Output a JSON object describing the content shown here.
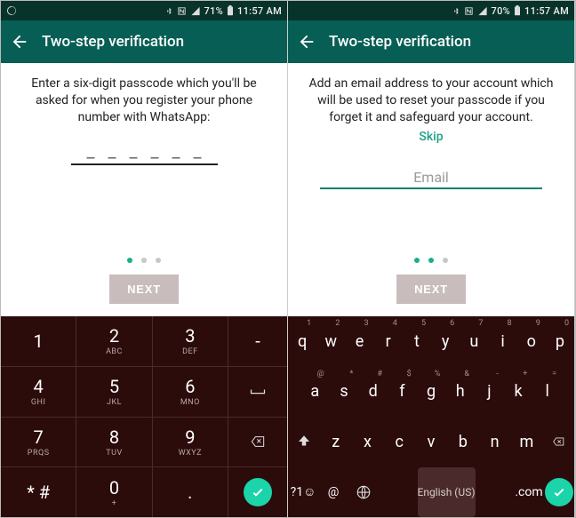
{
  "left": {
    "status": {
      "battery": "71%",
      "time": "11:57 AM"
    },
    "appbar": {
      "title": "Two-step verification"
    },
    "instruction": "Enter a six-digit passcode which you'll be asked for when you register your phone number with WhatsApp:",
    "dots": [
      true,
      false,
      false
    ],
    "next": "NEXT",
    "numpad": {
      "r1": [
        {
          "big": "1",
          "sub": ""
        },
        {
          "big": "2",
          "sub": "ABC"
        },
        {
          "big": "3",
          "sub": "DEF"
        },
        {
          "big": "-",
          "sub": ""
        }
      ],
      "r2": [
        {
          "big": "4",
          "sub": "GHI"
        },
        {
          "big": "5",
          "sub": "JKL"
        },
        {
          "big": "6",
          "sub": "MNO"
        },
        {
          "big": "␣",
          "sub": ""
        }
      ],
      "r3": [
        {
          "big": "7",
          "sub": "PRQS"
        },
        {
          "big": "8",
          "sub": "TUV"
        },
        {
          "big": "9",
          "sub": "WXYZ"
        },
        {
          "big": "⌫",
          "sub": ""
        }
      ],
      "r4": [
        {
          "big": "* #",
          "sub": ""
        },
        {
          "big": "0",
          "sub": "+"
        },
        {
          "big": ".",
          "sub": ""
        },
        {
          "big": "✓",
          "sub": ""
        }
      ]
    }
  },
  "right": {
    "status": {
      "battery": "70%",
      "time": "11:57 AM"
    },
    "appbar": {
      "title": "Two-step verification"
    },
    "instruction": "Add an email address to your account which will be used to reset your passcode if you forget it and safeguard your account.",
    "skip": "Skip",
    "email_placeholder": "Email",
    "dots": [
      true,
      true,
      false
    ],
    "next": "NEXT",
    "qwerty": {
      "r1": [
        {
          "m": "q",
          "h": "1"
        },
        {
          "m": "w",
          "h": "2"
        },
        {
          "m": "e",
          "h": "3"
        },
        {
          "m": "r",
          "h": "4"
        },
        {
          "m": "t",
          "h": "5"
        },
        {
          "m": "y",
          "h": "6"
        },
        {
          "m": "u",
          "h": "7"
        },
        {
          "m": "i",
          "h": "8"
        },
        {
          "m": "o",
          "h": "9"
        },
        {
          "m": "p",
          "h": "0"
        }
      ],
      "r2": [
        {
          "m": "a",
          "h": "@"
        },
        {
          "m": "s",
          "h": "*"
        },
        {
          "m": "d",
          "h": "#"
        },
        {
          "m": "f",
          "h": "$"
        },
        {
          "m": "g",
          "h": "%"
        },
        {
          "m": "h",
          "h": "&"
        },
        {
          "m": "j",
          "h": "-"
        },
        {
          "m": "k",
          "h": "+"
        },
        {
          "m": "l",
          "h": "="
        }
      ],
      "r3": [
        {
          "m": "⇧",
          "h": ""
        },
        {
          "m": "z",
          "h": ""
        },
        {
          "m": "x",
          "h": ""
        },
        {
          "m": "c",
          "h": ""
        },
        {
          "m": "v",
          "h": ""
        },
        {
          "m": "b",
          "h": ""
        },
        {
          "m": "n",
          "h": ""
        },
        {
          "m": "m",
          "h": ""
        },
        {
          "m": "⌫",
          "h": ""
        }
      ],
      "space_label": "English (US)",
      "bottom_left": "?1☺",
      "at": "@",
      "dotcom": ".com"
    }
  }
}
